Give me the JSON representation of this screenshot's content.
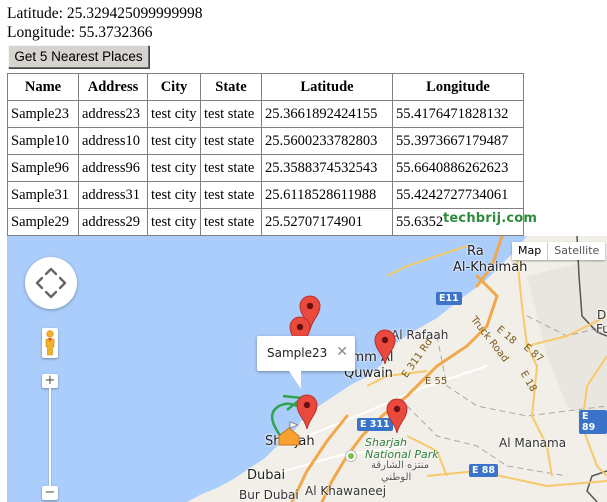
{
  "location": {
    "latitude_label": "Latitude:",
    "latitude_value": "25.329425099999998",
    "longitude_label": "Longitude:",
    "longitude_value": "55.3732366"
  },
  "button": {
    "label": "Get 5 Nearest Places"
  },
  "table": {
    "headers": [
      "Name",
      "Address",
      "City",
      "State",
      "Latitude",
      "Longitude"
    ],
    "rows": [
      [
        "Sample23",
        "address23",
        "test city",
        "test state",
        "25.3661892424155",
        "55.4176471828132"
      ],
      [
        "Sample10",
        "address10",
        "test city",
        "test state",
        "25.5600233782803",
        "55.3973667179487"
      ],
      [
        "Sample96",
        "address96",
        "test city",
        "test state",
        "25.3588374532543",
        "55.6640886262623"
      ],
      [
        "Sample31",
        "address31",
        "test city",
        "test state",
        "25.6118528611988",
        "55.4242727734061"
      ],
      [
        "Sample29",
        "address29",
        "test city",
        "test state",
        "25.52707174901",
        "55.6352"
      ]
    ]
  },
  "watermark": "techbrij.com",
  "map": {
    "type_controls": {
      "map": "Map",
      "satellite": "Satellite",
      "active": "Map"
    },
    "zoom_in": "+",
    "zoom_out": "−",
    "infowindow": {
      "title": "Sample23",
      "close": "✕"
    },
    "labels": {
      "ras_al_khaimah_partial": "Ra",
      "al_khaimah": "Al-Khaimah",
      "al_rafaah": "Al Rafaah",
      "umm_al": "Umm Al",
      "quwain": "Quwain",
      "sharjah": "Sharjah",
      "sharjah_park_1": "Sharjah",
      "sharjah_park_2": "National Park",
      "sharjah_park_ar1": "منتزه الشارقة",
      "sharjah_park_ar2": "الوطني",
      "dubai": "Dubai",
      "bur_dubai": "Bur Dubai",
      "al_khawaneej": "Al Khawaneej",
      "al_manama": "Al Manama",
      "dibba_partial_1": "Di",
      "dibba_partial_2": "Fu"
    },
    "roads": {
      "truck_road": "Truck Road",
      "e18_a": "E 18",
      "e18_b": "E 18",
      "e87": "E 87",
      "e55": "E 55",
      "e311_rd": "E 311 Rd",
      "e311": "E 311",
      "e11": "E11",
      "e88": "E 88",
      "e89": "E 89"
    },
    "colors": {
      "water": "#abcdfb",
      "land": "#f2efe9",
      "highway": "#f0a84a",
      "marker": "#ea4a3d"
    },
    "markers": [
      "Sample23",
      "Sample10",
      "Sample96",
      "Sample31",
      "Sample29"
    ],
    "current_location": "home"
  }
}
